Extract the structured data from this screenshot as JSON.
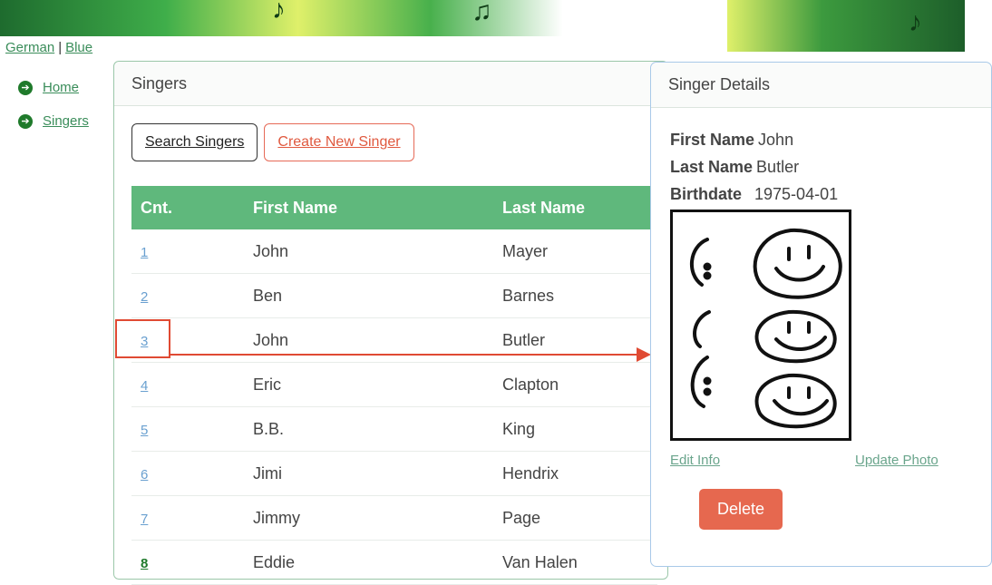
{
  "lang": {
    "german": "German",
    "sep": "|",
    "blue": "Blue"
  },
  "nav": [
    {
      "label": "Home"
    },
    {
      "label": "Singers"
    }
  ],
  "panel": {
    "title": "Singers",
    "search_btn": "Search Singers",
    "create_btn": "Create New Singer"
  },
  "table": {
    "headers": [
      "Cnt.",
      "First Name",
      "Last Name"
    ],
    "rows": [
      {
        "cnt": "1",
        "first": "John",
        "last": "Mayer"
      },
      {
        "cnt": "2",
        "first": "Ben",
        "last": "Barnes"
      },
      {
        "cnt": "3",
        "first": "John",
        "last": "Butler"
      },
      {
        "cnt": "4",
        "first": "Eric",
        "last": "Clapton"
      },
      {
        "cnt": "5",
        "first": "B.B.",
        "last": "King"
      },
      {
        "cnt": "6",
        "first": "Jimi",
        "last": "Hendrix"
      },
      {
        "cnt": "7",
        "first": "Jimmy",
        "last": "Page"
      },
      {
        "cnt": "8",
        "first": "Eddie",
        "last": "Van Halen"
      }
    ]
  },
  "details": {
    "title": "Singer Details",
    "first_label": "First Name",
    "first_value": "John",
    "last_label": "Last Name",
    "last_value": "Butler",
    "birth_label": "Birthdate",
    "birth_value": "1975-04-01",
    "edit_link": "Edit Info",
    "photo_link": "Update Photo",
    "delete_btn": "Delete"
  },
  "colors": {
    "accent_green": "#5fb87c",
    "link_green": "#3a8d5a",
    "danger": "#e6684f",
    "annotation_red": "#e04a33"
  }
}
